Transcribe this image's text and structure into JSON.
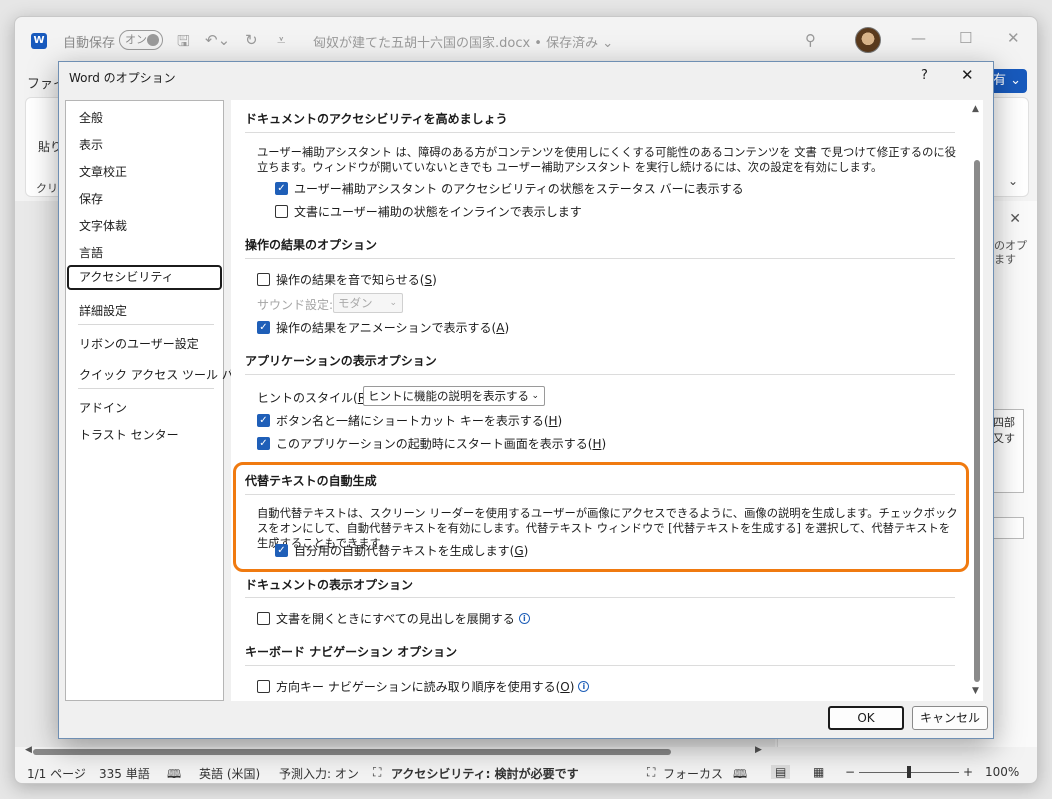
{
  "titlebar": {
    "autosave_label": "自動保存",
    "autosave_state": "オン",
    "doc_title": "匈奴が建てた五胡十六国の国家.docx • 保存済み ⌄",
    "minimize": "—",
    "maximize": "☐",
    "close": "✕"
  },
  "ribbon": {
    "file_tab": "ファイル",
    "share_button": "有 ⌄",
    "paste_label": "貼り",
    "clipboard_label": "クリッ",
    "collapse": "⌄"
  },
  "side_pane": {
    "close": "✕",
    "text": "のオプ\nます",
    "box_text": "四部\n又す"
  },
  "statusbar": {
    "page": "1/1 ページ",
    "words": "335 単語",
    "language": "英語 (米国)",
    "prediction": "予測入力: オン",
    "accessibility": "アクセシビリティ: 検討が必要です",
    "focus": "フォーカス",
    "zoom": "100%"
  },
  "dialog": {
    "title": "Word のオプション",
    "help": "?",
    "close": "✕",
    "nav": [
      "全般",
      "表示",
      "文章校正",
      "保存",
      "文字体裁",
      "言語",
      "アクセシビリティ",
      "詳細設定",
      "リボンのユーザー設定",
      "クイック アクセス ツール バー",
      "アドイン",
      "トラスト センター"
    ],
    "active_nav": "アクセシビリティ",
    "sections": {
      "doc_accessibility": {
        "header": "ドキュメントのアクセシビリティを高めましょう",
        "description": "ユーザー補助アシスタント は、障碍のある方がコンテンツを使用しにくくする可能性のあるコンテンツを 文書 で見つけて修正するのに役立ちます。ウィンドウが開いていないときでも ユーザー補助アシスタント を実行し続けるには、次の設定を有効にします。",
        "opt_status_bar": "ユーザー補助アシスタント のアクセシビリティの状態をステータス バーに表示する",
        "opt_status_bar_checked": true,
        "opt_inline": "文書にユーザー補助の状態をインラインで表示します",
        "opt_inline_checked": false
      },
      "feedback": {
        "header": "操作の結果のオプション",
        "opt_sound": "操作の結果を音で知らせる(",
        "opt_sound_key": "S",
        "opt_sound_checked": false,
        "sound_setting_label": "サウンド設定:",
        "sound_setting_value": "モダン",
        "opt_animation": "操作の結果をアニメーションで表示する(",
        "opt_animation_key": "A",
        "opt_animation_checked": true
      },
      "app_display": {
        "header": "アプリケーションの表示オプション",
        "tooltip_label": "ヒントのスタイル(",
        "tooltip_key": "R",
        "tooltip_label_end": "):",
        "tooltip_value": "ヒントに機能の説明を表示する",
        "opt_shortcut": "ボタン名と一緒にショートカット キーを表示する(",
        "opt_shortcut_key": "H",
        "opt_shortcut_checked": true,
        "opt_start": "このアプリケーションの起動時にスタート画面を表示する(",
        "opt_start_key": "H",
        "opt_start_checked": true
      },
      "alt_text": {
        "header": "代替テキストの自動生成",
        "description": "自動代替テキストは、スクリーン リーダーを使用するユーザーが画像にアクセスできるように、画像の説明を生成します。チェックボックスをオンにして、自動代替テキストを有効にします。代替テキスト ウィンドウで [代替テキストを生成する] を選択して、代替テキストを生成することもできます。",
        "opt_auto": "自分用の自動代替テキストを生成します(",
        "opt_auto_key": "G",
        "opt_auto_checked": true
      },
      "doc_display": {
        "header": "ドキュメントの表示オプション",
        "opt_expand": "文書を開くときにすべての見出しを展開する",
        "opt_expand_checked": false
      },
      "keyboard_nav": {
        "header": "キーボード ナビゲーション オプション",
        "opt_arrow": "方向キー ナビゲーションに読み取り順序を使用する(",
        "opt_arrow_key": "O",
        "opt_arrow_checked": false
      }
    },
    "ok_label": "OK",
    "cancel_label": "キャンセル",
    "highlight_color": "#f07a10",
    "accent_color": "#1f5fb8"
  }
}
